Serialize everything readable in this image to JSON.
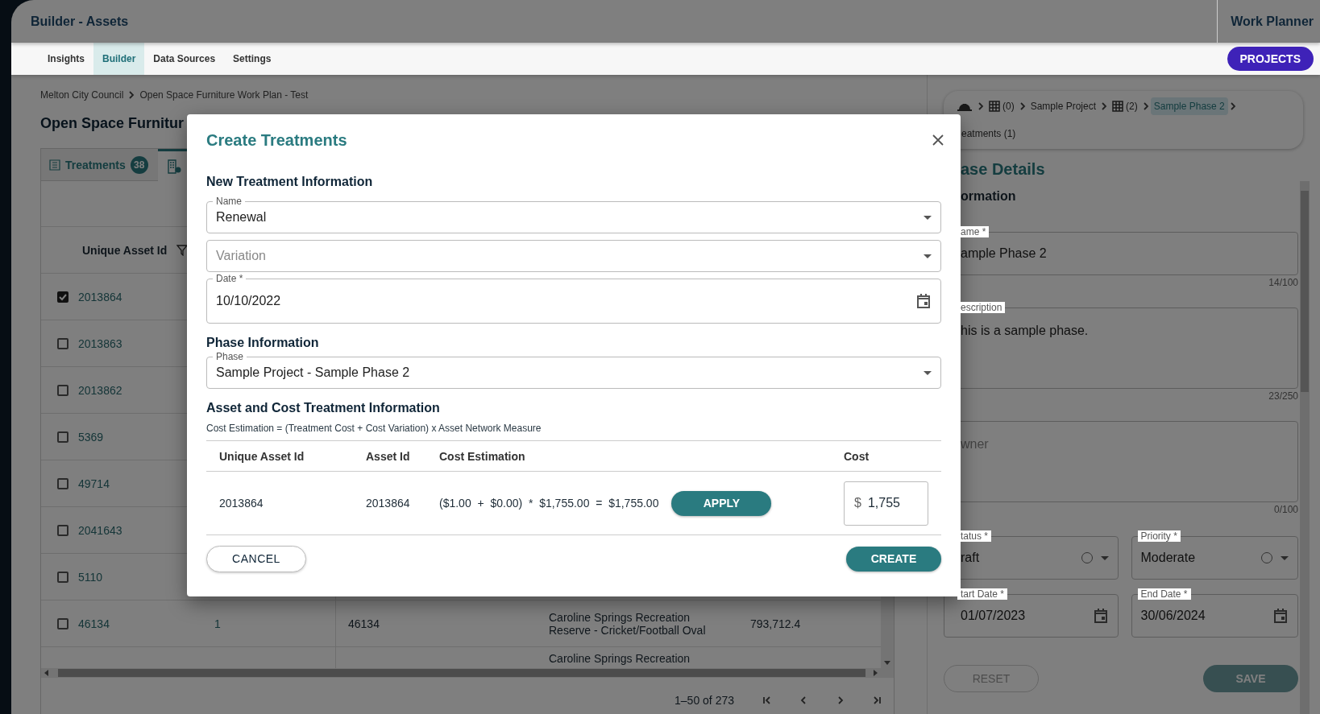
{
  "header": {
    "title": "Builder - Assets",
    "app_name": "Work Planner"
  },
  "nav": {
    "tabs": [
      {
        "label": "Insights",
        "selected": false
      },
      {
        "label": "Builder",
        "selected": true
      },
      {
        "label": "Data Sources",
        "selected": false
      },
      {
        "label": "Settings",
        "selected": false
      }
    ],
    "projects_button": "PROJECTS"
  },
  "breadcrumb": [
    "Melton City Council",
    "Open Space Furniture Work Plan - Test"
  ],
  "page_title": "Open Space Furnitur",
  "content_tabs": [
    {
      "label": "Treatments",
      "count": "38",
      "selected": false
    },
    {
      "selected": true
    }
  ],
  "table": {
    "columns": [
      "Unique Asset Id"
    ],
    "rows": [
      {
        "checked": true,
        "unique_asset_id": "2013864"
      },
      {
        "checked": false,
        "unique_asset_id": "2013863"
      },
      {
        "checked": false,
        "unique_asset_id": "2013862"
      },
      {
        "checked": false,
        "unique_asset_id": "5369"
      },
      {
        "checked": false,
        "unique_asset_id": "49714"
      },
      {
        "checked": false,
        "unique_asset_id": "2041643"
      },
      {
        "checked": false,
        "unique_asset_id": "5110"
      },
      {
        "checked": false,
        "unique_asset_id": "46134",
        "column_2": "1",
        "column_3": "46134",
        "column_4": "Caroline Springs Recreation Reserve - Cricket/Football Oval",
        "column_5": "793,712.4"
      },
      {
        "column_4": "Caroline Springs Recreation"
      }
    ],
    "pagination": "1–50 of 273"
  },
  "side_panel": {
    "breadcrumb": [
      {
        "kind": "home",
        "selected": false
      },
      {
        "kind": "group",
        "label": "(0)",
        "selected": false
      },
      {
        "kind": "text",
        "label": "Sample Project",
        "selected": false
      },
      {
        "kind": "group",
        "label": "(2)",
        "selected": false
      },
      {
        "kind": "text",
        "label": "Sample Phase 2",
        "selected": true
      },
      {
        "kind": "text",
        "label": "eatments (1)",
        "selected": false
      }
    ],
    "title": "ase Details",
    "section": "ormation",
    "fields": [
      {
        "kind": "text",
        "label": "ame *",
        "value": "ample Phase 2",
        "counter": "14/100"
      },
      {
        "kind": "textarea",
        "label": "escription",
        "value": "his is a sample phase.",
        "counter": "23/250"
      },
      {
        "kind": "textarea",
        "placeholder": "wner",
        "counter": "0/100"
      }
    ],
    "status": {
      "label": "tatus *",
      "value": "raft"
    },
    "priority": {
      "label": "Priority *",
      "value": "Moderate"
    },
    "start_date": {
      "label": "tart Date *",
      "value": "01/07/2023"
    },
    "end_date": {
      "label": "End Date *",
      "value": "30/06/2024"
    },
    "reset_button": {
      "label": "RESET",
      "disabled": true
    },
    "save_button": {
      "label": "SAVE",
      "disabled": true
    }
  },
  "dialog": {
    "title": "Create Treatments",
    "new_treatment": {
      "heading": "New Treatment Information",
      "name": {
        "label": "Name",
        "value": "Renewal"
      },
      "variation": {
        "placeholder": "Variation"
      },
      "date": {
        "label": "Date *",
        "value": "10/10/2022"
      }
    },
    "phase": {
      "heading": "Phase Information",
      "field": {
        "label": "Phase",
        "value": "Sample Project - Sample Phase 2"
      }
    },
    "cost": {
      "heading": "Asset and Cost Treatment Information",
      "formula": "Cost Estimation = (Treatment Cost + Cost Variation) x Asset Network Measure",
      "columns": [
        "Unique Asset Id",
        "Asset Id",
        "Cost Estimation",
        "Cost"
      ],
      "rows": [
        {
          "unique_asset_id": "2013864",
          "asset_id": "2013864",
          "cost_estimation": "($1.00  +  $0.00)  *  $1,755.00  =  $1,755.00",
          "apply_button": "APPLY",
          "currency": "$",
          "cost": "1,755"
        }
      ]
    },
    "cancel_button": "CANCEL",
    "create_button": "CREATE"
  }
}
